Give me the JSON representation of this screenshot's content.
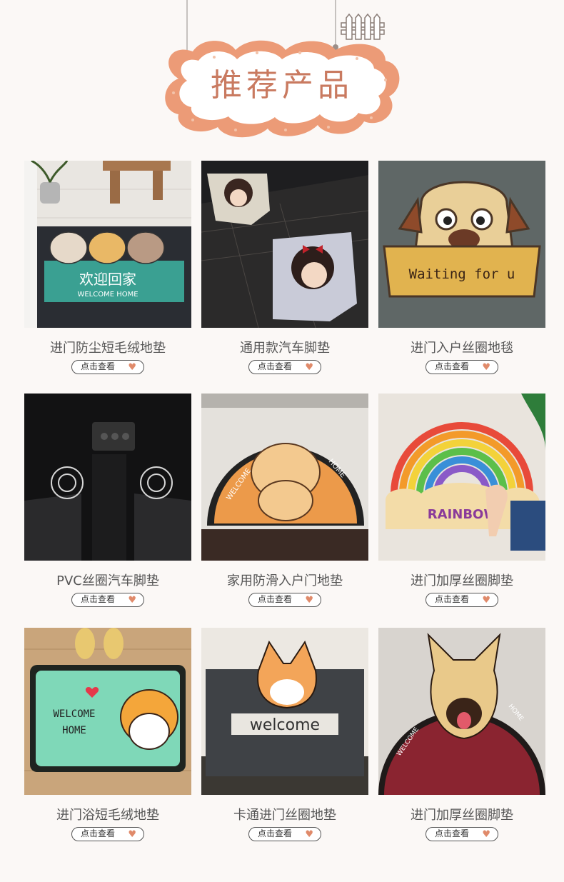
{
  "header": {
    "title": "推荐产品"
  },
  "button_label": "点击查看",
  "colors": {
    "accent": "#e8956f",
    "title": "#c97a60",
    "heart": "#e08a6a"
  },
  "products": [
    {
      "name": "进门防尘短毛绒地垫",
      "mat_text": "欢迎回家",
      "mat_subtext": "WELCOME HOME"
    },
    {
      "name": "通用款汽车脚垫"
    },
    {
      "name": "进门入户丝圈地毯",
      "mat_text": "Waiting for u"
    },
    {
      "name": "PVC丝圈汽车脚垫"
    },
    {
      "name": "家用防滑入户门地垫",
      "mat_text": "WELCOME",
      "mat_subtext": "HOME"
    },
    {
      "name": "进门加厚丝圈脚垫",
      "mat_text": "RAINBOW"
    },
    {
      "name": "进门浴短毛绒地垫",
      "mat_text": "WELCOME",
      "mat_subtext": "HOME"
    },
    {
      "name": "卡通进门丝圈地垫",
      "mat_text": "welcome"
    },
    {
      "name": "进门加厚丝圈脚垫",
      "mat_text": "WELCOME",
      "mat_subtext": "HOME"
    }
  ]
}
